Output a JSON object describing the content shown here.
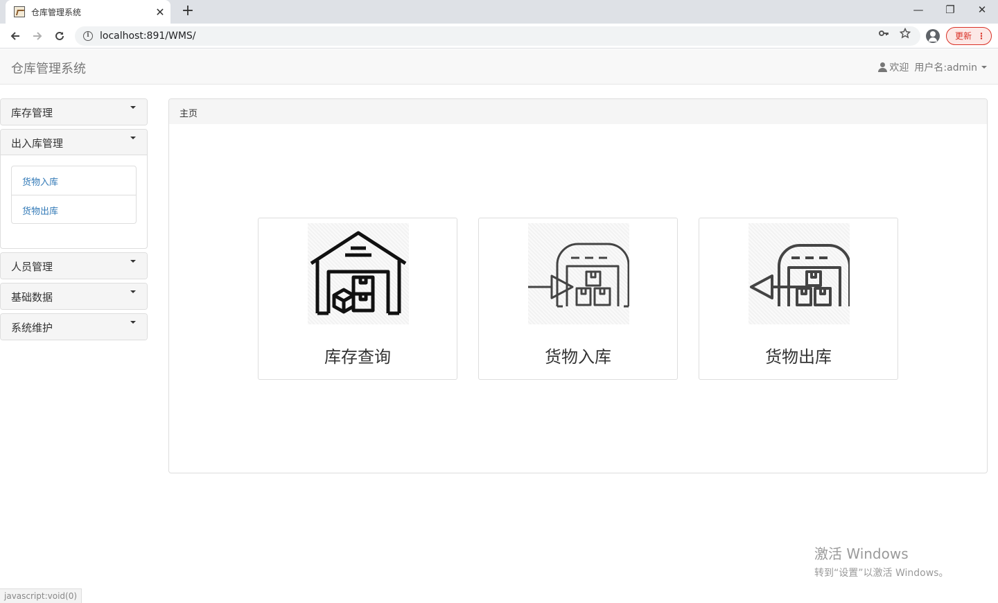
{
  "browser": {
    "tab_title": "仓库管理系统",
    "tab_close": "✕",
    "new_tab": "+",
    "url": "localhost:891/WMS/",
    "update_label": "更新",
    "window_minimize": "—",
    "window_restore": "❐",
    "window_close": "✕",
    "icons": [
      "back-icon",
      "forward-icon",
      "reload-icon",
      "info-icon",
      "key-icon",
      "star-icon",
      "profile-icon",
      "more-icon"
    ]
  },
  "navbar": {
    "brand": "仓库管理系统",
    "welcome": "欢迎",
    "username": "用户名:admin"
  },
  "sidebar": {
    "menus": [
      {
        "label": "库存管理",
        "open": false
      },
      {
        "label": "出入库管理",
        "open": true,
        "items": [
          "货物入库",
          "货物出库"
        ]
      },
      {
        "label": "人员管理",
        "open": false
      },
      {
        "label": "基础数据",
        "open": false
      },
      {
        "label": "系统维护",
        "open": false
      }
    ]
  },
  "main": {
    "breadcrumb": "主页",
    "cards": [
      {
        "label": "库存查询",
        "icon": "warehouse-boxes-icon"
      },
      {
        "label": "货物入库",
        "icon": "warehouse-inbound-icon"
      },
      {
        "label": "货物出库",
        "icon": "warehouse-outbound-icon"
      }
    ]
  },
  "overlay": {
    "watermark_title": "激活 Windows",
    "watermark_hint": "转到“设置”以激活 Windows。",
    "status_text": "javascript:void(0)"
  },
  "colors": {
    "link": "#337ab7",
    "panel_heading": "#f5f5f5",
    "navbar_bg": "#f8f8f8",
    "update_red": "#d93025"
  }
}
